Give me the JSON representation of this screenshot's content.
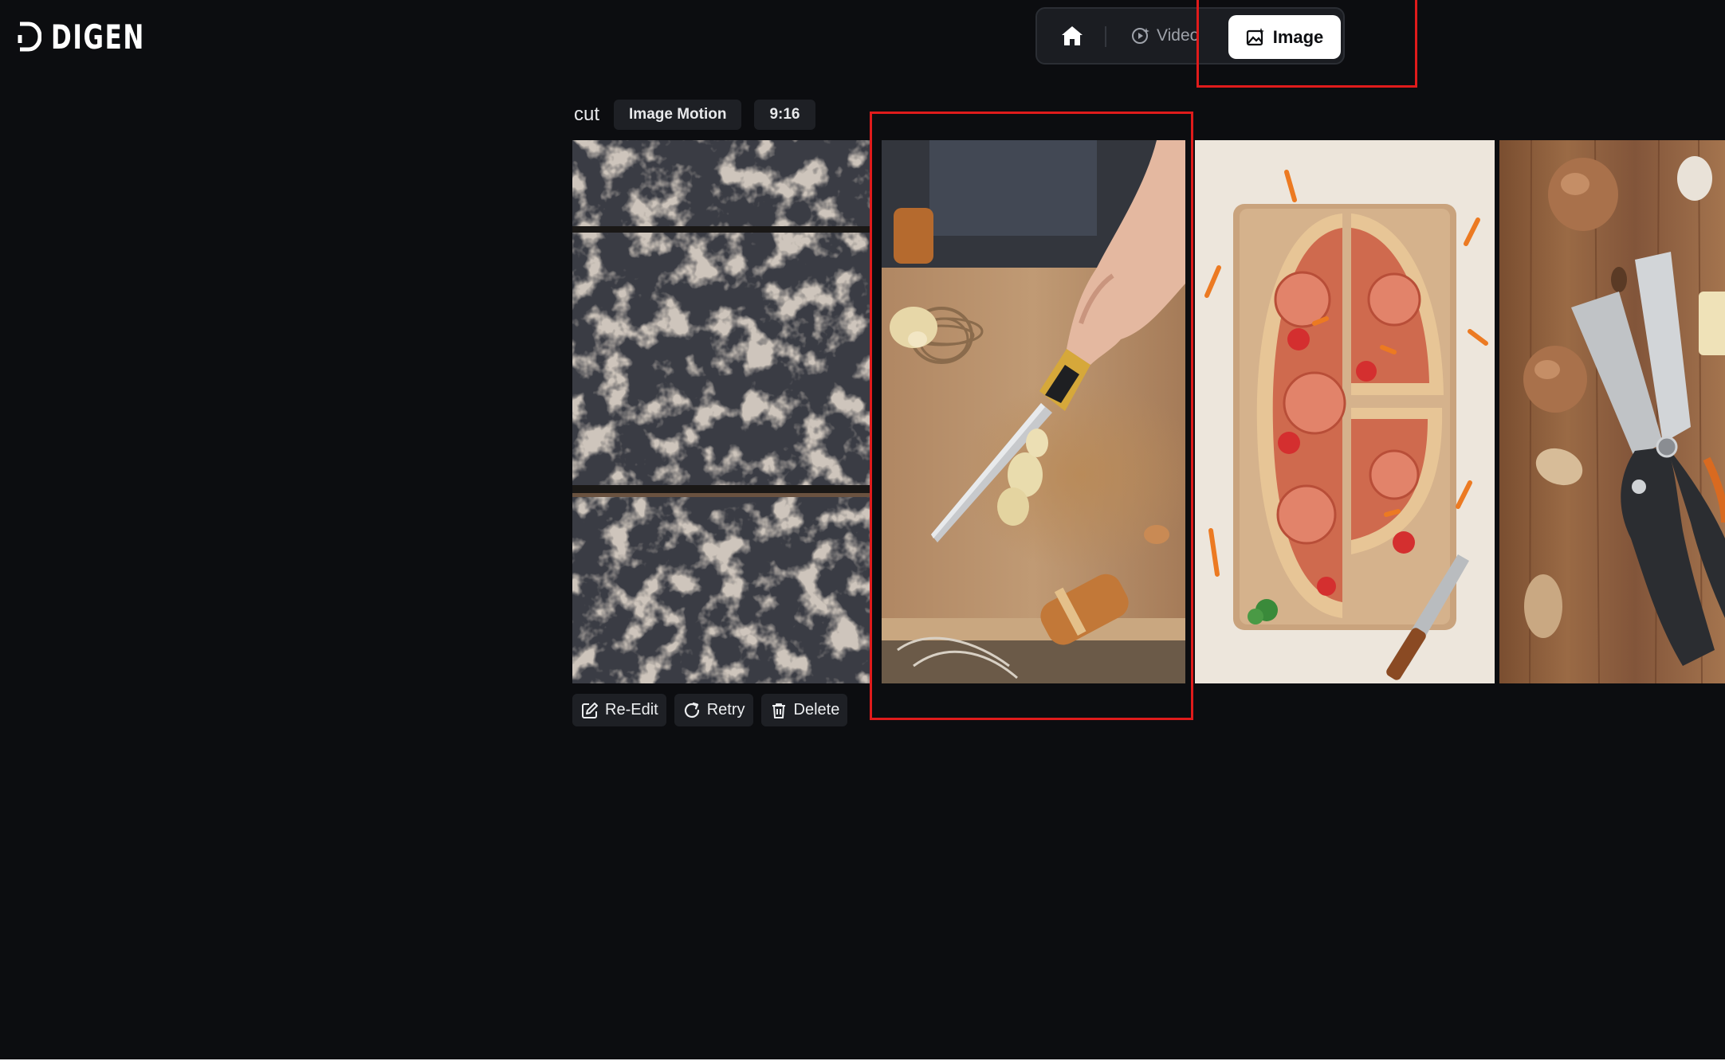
{
  "app": {
    "brand": "DIGEN"
  },
  "nav": {
    "home_label": "",
    "video_label": "Video",
    "image_label": "Image",
    "active": "Image"
  },
  "task": {
    "prompt": "cut",
    "mode_tag": "Image Motion",
    "ratio_tag": "9:16"
  },
  "actions": {
    "reedit": "Re-Edit",
    "retry": "Retry",
    "delete": "Delete"
  },
  "results": [
    {
      "subject": "stone-texture"
    },
    {
      "subject": "knife-cutting-board"
    },
    {
      "subject": "pizza-halves"
    },
    {
      "subject": "scissors-nuts"
    }
  ],
  "colors": {
    "background": "#0c0d10",
    "surface": "#1e2025",
    "accent_active": "#ffffff",
    "highlight": "#e01b1b"
  },
  "icons": [
    "logo-icon",
    "home-icon",
    "video-icon",
    "image-icon",
    "edit-icon",
    "retry-icon",
    "trash-icon"
  ]
}
